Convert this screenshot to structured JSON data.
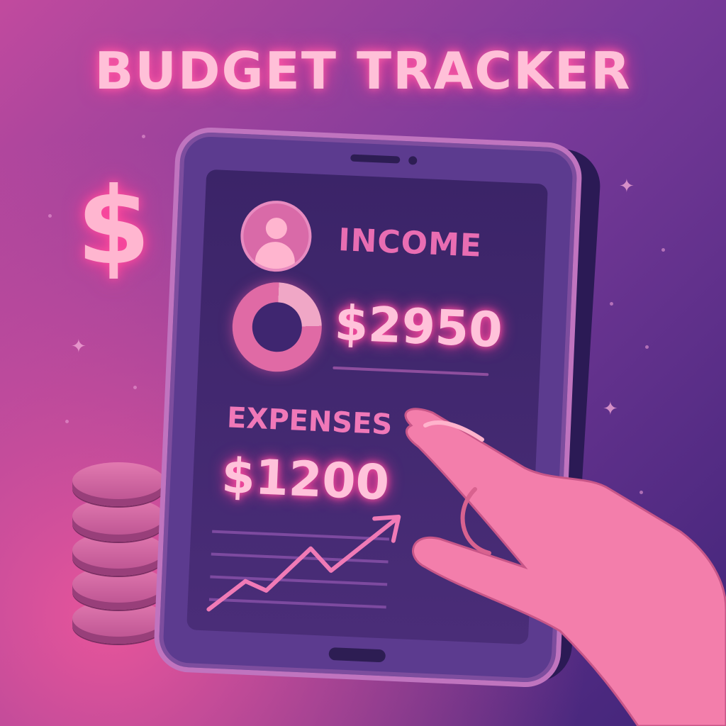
{
  "header": {
    "title": "BUDGET TRACKER"
  },
  "decor": {
    "dollar_symbol": "$"
  },
  "dashboard": {
    "income": {
      "label": "INCOME",
      "value": "$2950",
      "chart_fraction": 0.24
    },
    "expenses": {
      "label": "EXPENSES",
      "value": "$1200"
    },
    "trend_icon": "trend-up-chart-icon"
  },
  "colors": {
    "accent_pink": "#ff4fa1",
    "background_start": "#c14a9e",
    "background_end": "#3f2478",
    "screen": "#3b2468"
  }
}
